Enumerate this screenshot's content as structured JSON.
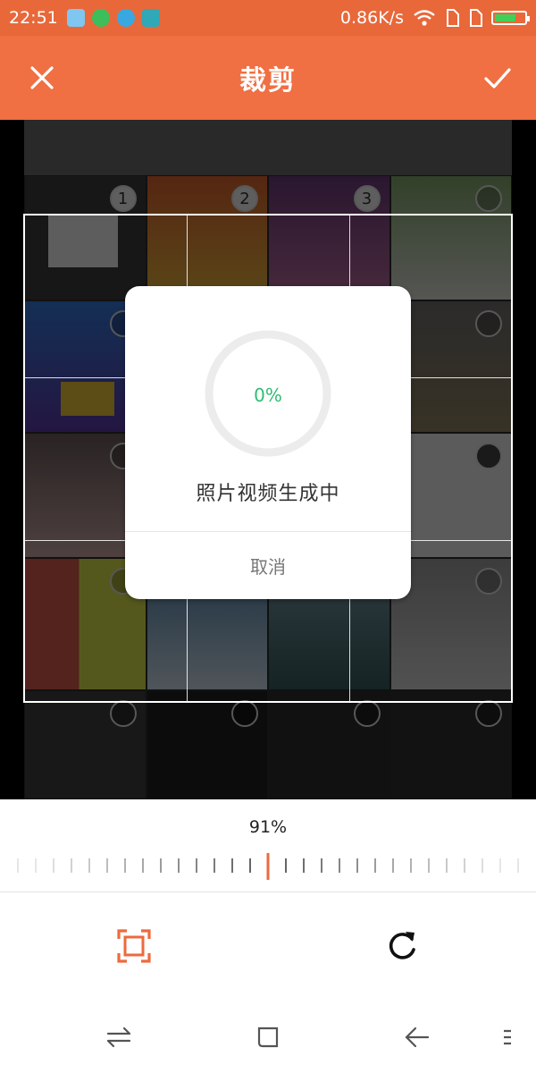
{
  "status_bar": {
    "time": "22:51",
    "network_speed": "0.86K/s",
    "battery_level": 0.7,
    "icons": [
      "app-notification-icon",
      "message-icon",
      "browser-icon",
      "usb-icon",
      "wifi-icon",
      "sim-icon",
      "sim-icon",
      "battery-icon"
    ]
  },
  "header": {
    "title": "裁剪",
    "close_icon": "close-icon",
    "confirm_icon": "check-icon",
    "background": "#f06f43"
  },
  "canvas": {
    "photo_badges": [
      "1",
      "2",
      "3"
    ]
  },
  "dialog": {
    "progress_text": "0%",
    "progress": 0,
    "message": "照片视频生成中",
    "cancel_label": "取消",
    "accent": "#2ebd72"
  },
  "controls": {
    "zoom_label": "91%",
    "crop_tool_icon": "crop-frame-icon",
    "rotate_tool_icon": "rotate-icon",
    "accent": "#ee6a3c"
  },
  "nav_bar": {
    "icons": [
      "switch-apps-icon",
      "home-icon",
      "back-icon",
      "menu-icon"
    ]
  }
}
